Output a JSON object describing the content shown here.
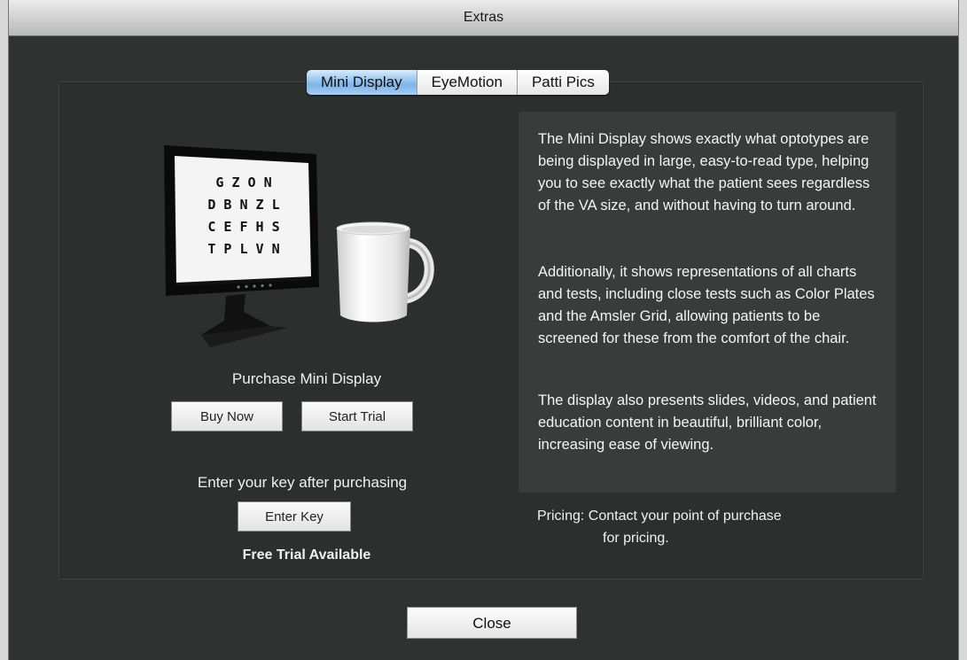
{
  "window": {
    "title": "Extras"
  },
  "tabs": [
    {
      "label": "Mini Display",
      "active": true
    },
    {
      "label": "EyeMotion",
      "active": false
    },
    {
      "label": "Patti Pics",
      "active": false
    }
  ],
  "illustration": {
    "chart_rows": [
      "G Z O N",
      "D B N Z L",
      "C E F H S",
      "T P L V N"
    ]
  },
  "purchase": {
    "heading": "Purchase Mini Display",
    "buy_label": "Buy Now",
    "trial_label": "Start Trial",
    "key_prompt": "Enter your key after purchasing",
    "enter_key_label": "Enter Key",
    "free_trial_note": "Free Trial Available"
  },
  "description": {
    "paragraphs": [
      "The Mini Display shows exactly what optotypes are being displayed in large, easy-to-read type, helping you to see exactly what the patient sees regardless of the VA size, and without having to turn around.",
      "Additionally, it shows representations of all charts and tests, including close tests such as Color Plates and the Amsler Grid, allowing patients to be screened for these from the comfort of the chair.",
      "The display also presents slides, videos, and patient education content in beautiful, brilliant color, increasing ease of viewing."
    ]
  },
  "pricing": {
    "line1": "Pricing: Contact your point of purchase",
    "line2": "for pricing."
  },
  "footer": {
    "close_label": "Close"
  }
}
